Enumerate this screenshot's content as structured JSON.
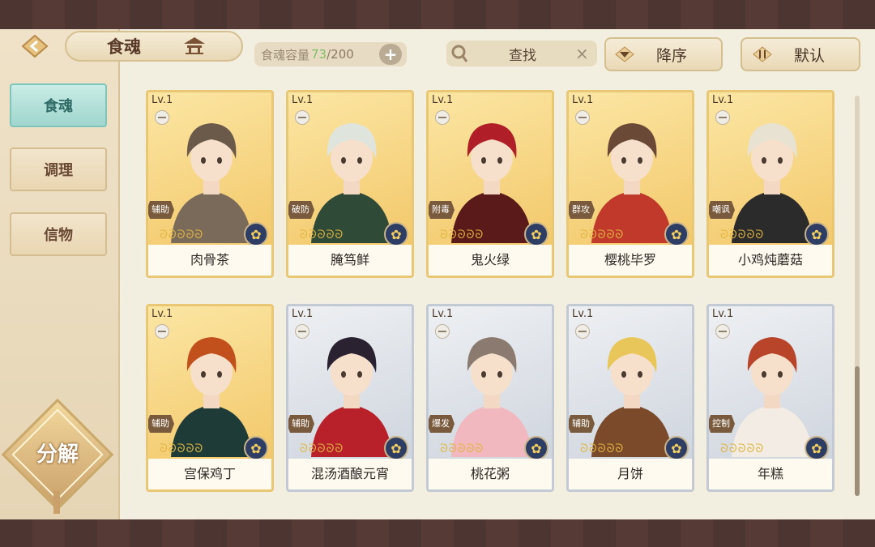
{
  "header": {
    "title": "食魂",
    "capacity_label": "食魂容量",
    "capacity_current": "73",
    "capacity_max": "/200",
    "plus_label": "+",
    "search_placeholder": "查找",
    "clear_label": "×",
    "sort_desc_label": "降序",
    "sort_default_label": "默认"
  },
  "sidebar": {
    "tabs": [
      {
        "label": "食魂",
        "active": true
      },
      {
        "label": "调理",
        "active": false
      },
      {
        "label": "信物",
        "active": false
      }
    ],
    "decompose_label": "分解"
  },
  "cards": [
    {
      "level": "Lv.1",
      "name": "肉骨茶",
      "role": "辅助",
      "frame": "gold",
      "hair": "#6b5a4a",
      "outfit": "#7a6a5a"
    },
    {
      "level": "Lv.1",
      "name": "腌笃鲜",
      "role": "破防",
      "frame": "gold",
      "hair": "#dfe5dd",
      "outfit": "#2f4a36"
    },
    {
      "level": "Lv.1",
      "name": "鬼火绿",
      "role": "附毒",
      "frame": "gold",
      "hair": "#b01f28",
      "outfit": "#5a1a1a"
    },
    {
      "level": "Lv.1",
      "name": "樱桃毕罗",
      "role": "群攻",
      "frame": "gold",
      "hair": "#6a4a36",
      "outfit": "#c0392b"
    },
    {
      "level": "Lv.1",
      "name": "小鸡炖蘑菇",
      "role": "嘲讽",
      "frame": "gold",
      "hair": "#e8e2d2",
      "outfit": "#2b2b2b"
    },
    {
      "level": "Lv.1",
      "name": "宫保鸡丁",
      "role": "辅助",
      "frame": "gold",
      "hair": "#c2501c",
      "outfit": "#1f3b38"
    },
    {
      "level": "Lv.1",
      "name": "混汤酒酿元宵",
      "role": "辅助",
      "frame": "silver",
      "hair": "#2a2230",
      "outfit": "#b8202a"
    },
    {
      "level": "Lv.1",
      "name": "桃花粥",
      "role": "爆发",
      "frame": "silver",
      "hair": "#8a7a70",
      "outfit": "#f1b8c0"
    },
    {
      "level": "Lv.1",
      "name": "月饼",
      "role": "辅助",
      "frame": "silver",
      "hair": "#e9c65a",
      "outfit": "#7a4a2a"
    },
    {
      "level": "Lv.1",
      "name": "年糕",
      "role": "控制",
      "frame": "silver",
      "hair": "#b8452a",
      "outfit": "#f2ece4"
    }
  ],
  "star_glyphs": "ᘐᘐᘐᘐᘐ",
  "colors": {
    "accent_teal": "#9fd6cd",
    "gold_frame": "#e9c875",
    "silver_frame": "#c4cad4",
    "capacity_green": "#7fbf63"
  }
}
